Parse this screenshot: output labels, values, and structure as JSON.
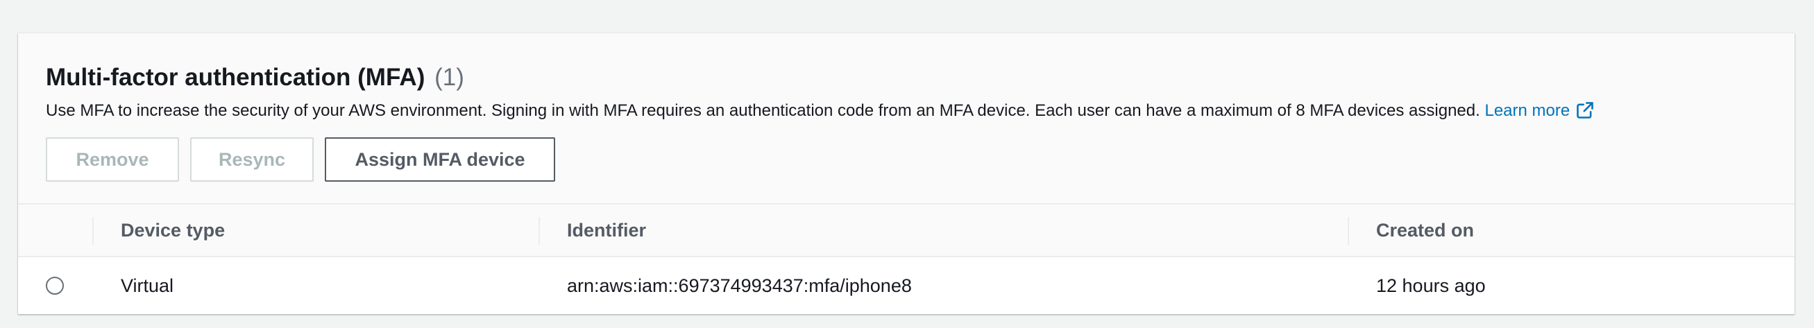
{
  "mfa_panel": {
    "title": "Multi-factor authentication (MFA)",
    "count": "(1)",
    "description": "Use MFA to increase the security of your AWS environment. Signing in with MFA requires an authentication code from an MFA device. Each user can have a maximum of 8 MFA devices assigned.",
    "learn_more_label": "Learn more",
    "learn_more_icon": "external-link-icon",
    "buttons": {
      "remove": "Remove",
      "resync": "Resync",
      "assign": "Assign MFA device"
    },
    "table": {
      "columns": [
        "Device type",
        "Identifier",
        "Created on"
      ],
      "rows": [
        {
          "selected": false,
          "device_type": "Virtual",
          "identifier": "arn:aws:iam::697374993437:mfa/iphone8",
          "created_on": "12 hours ago"
        }
      ]
    }
  },
  "colors": {
    "link": "#0073bb",
    "text": "#16191f",
    "secondary_text": "#687078",
    "disabled": "#aab7b8",
    "header_bg": "#fafafa",
    "page_bg": "#f2f3f3"
  }
}
